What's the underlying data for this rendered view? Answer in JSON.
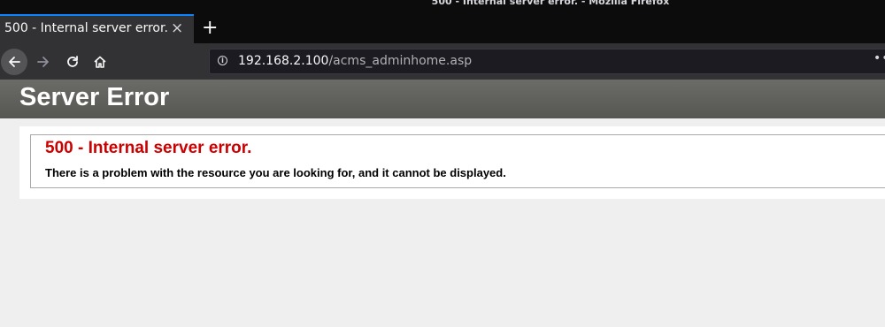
{
  "window": {
    "title": "500 - Internal server error. - Mozilla Firefox"
  },
  "tab": {
    "title": "500 - Internal server error.",
    "close_icon": "×",
    "new_tab_icon": "+"
  },
  "navbar": {
    "back_icon": "←",
    "forward_icon": "→",
    "reload_icon": "↻",
    "home_icon": "⌂",
    "url_host": "192.168.2.100",
    "url_path": "/acms_adminhome.asp",
    "page_actions_icon": "••"
  },
  "page": {
    "header_title": "Server Error",
    "error_title": "500 - Internal server error.",
    "error_description": "There is a problem with the resource you are looking for, and it cannot be displayed."
  },
  "colors": {
    "accent_tab": "#0a84ff",
    "error_red": "#cc0000",
    "header_band": "#5e5e5a"
  }
}
